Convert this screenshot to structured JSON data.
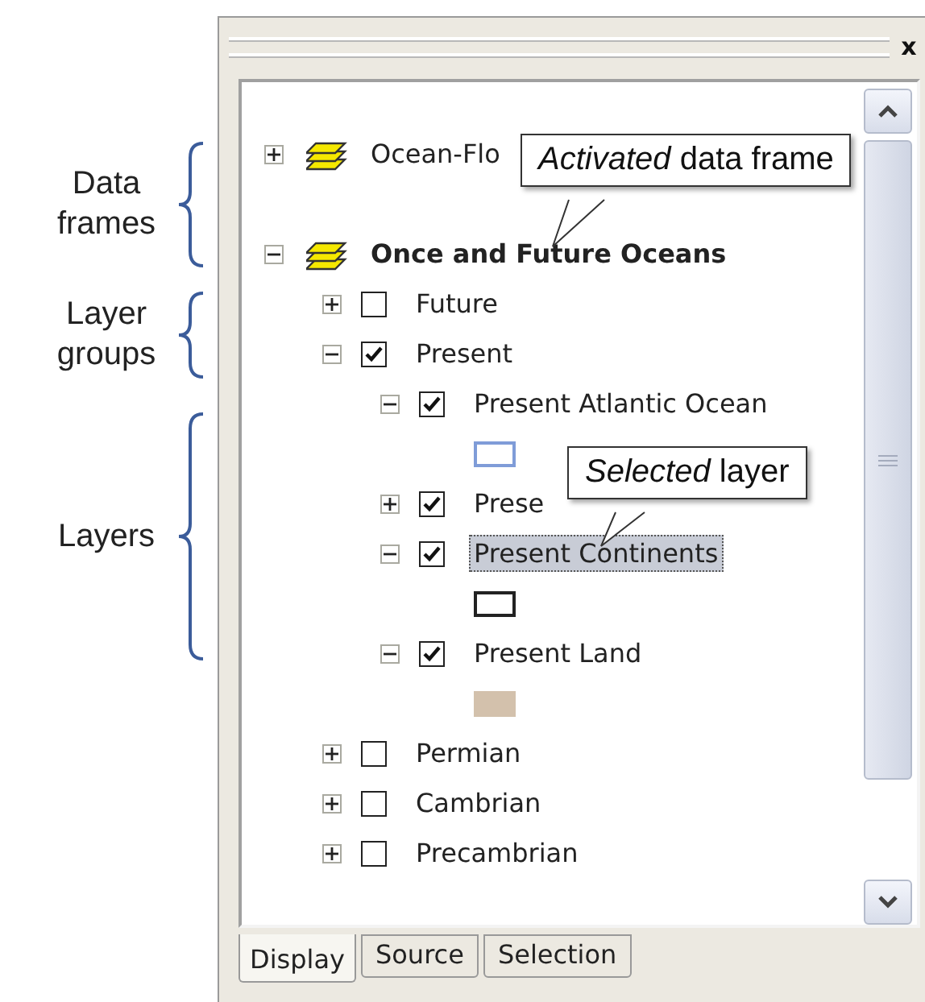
{
  "annotations": [
    {
      "label": "Data frames"
    },
    {
      "label": "Layer groups"
    },
    {
      "label": "Layers"
    }
  ],
  "panel": {
    "close": "x"
  },
  "frames": [
    {
      "name": "Ocean-Flo",
      "expanded": false,
      "activated": false
    },
    {
      "name": "Once and Future Oceans",
      "expanded": true,
      "activated": true,
      "children": [
        {
          "name": "Future",
          "expanded": false,
          "checked": false
        },
        {
          "name": "Present",
          "expanded": true,
          "checked": true,
          "children": [
            {
              "name": "Present Atlantic Ocean",
              "expanded": true,
              "checked": true,
              "selected": false,
              "symbol": {
                "kind": "outline",
                "color": "#7f9cd8"
              }
            },
            {
              "name": "Prese",
              "expanded": false,
              "checked": true,
              "selected": false
            },
            {
              "name": "Present Continents",
              "expanded": true,
              "checked": true,
              "selected": true,
              "symbol": {
                "kind": "outline",
                "color": "#222222"
              }
            },
            {
              "name": "Present Land",
              "expanded": true,
              "checked": true,
              "selected": false,
              "symbol": {
                "kind": "fill",
                "color": "#d3c1ac"
              }
            }
          ]
        },
        {
          "name": "Permian",
          "expanded": false,
          "checked": false
        },
        {
          "name": "Cambrian",
          "expanded": false,
          "checked": false
        },
        {
          "name": "Precambrian",
          "expanded": false,
          "checked": false
        }
      ]
    }
  ],
  "callouts": [
    {
      "text": "*Activated* data frame"
    },
    {
      "text": "*Selected* layer"
    }
  ],
  "tabs": [
    {
      "label": "Display",
      "selected": true
    },
    {
      "label": "Source",
      "selected": false
    },
    {
      "label": "Selection",
      "selected": false
    }
  ]
}
